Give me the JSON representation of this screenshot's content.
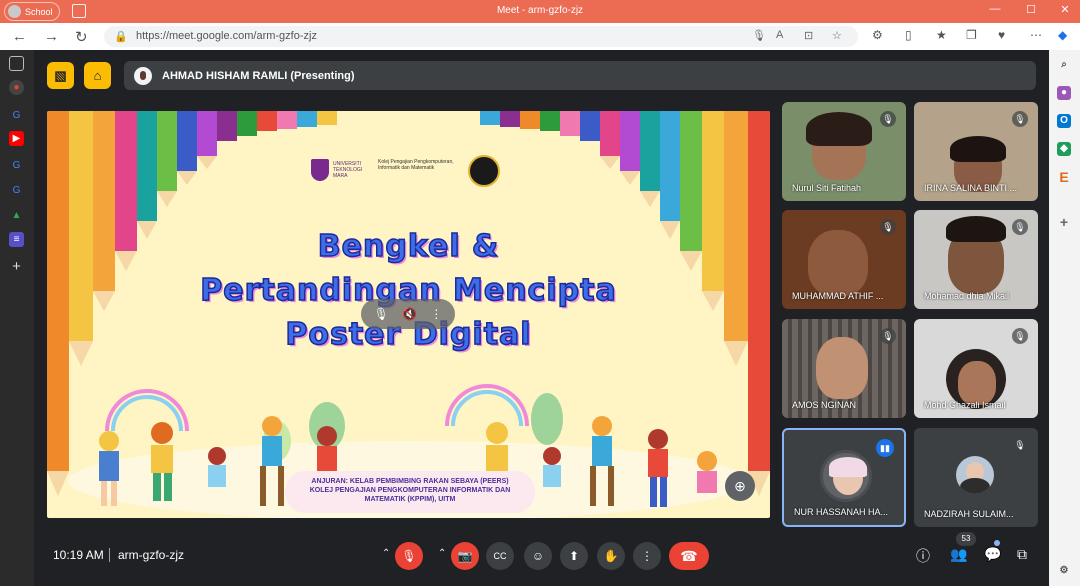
{
  "browser": {
    "profile_label": "School",
    "window_title": "Meet - arm-gzfo-zjz",
    "url": "https://meet.google.com/arm-gzfo-zjz"
  },
  "meet": {
    "presenter_label": "AHMAD HISHAM RAMLI (Presenting)",
    "time": "10:19 AM",
    "meeting_code": "arm-gzfo-zjz",
    "participant_count": "53"
  },
  "slide": {
    "title_line1": "Bengkel &",
    "title_line2": "Pertandingan Mencipta",
    "title_line3": "Poster Digital",
    "uitm_text": "UNIVERSITI TEKNOLOGI MARA",
    "kolej_text": "Kolej Pengajian Pengkomputeran, Informatik dan Matematik",
    "anjuran_line1": "ANJURAN: KELAB PEMBIMBING RAKAN SEBAYA (PEERS)",
    "anjuran_line2": "KOLEJ PENGAJIAN PENGKOMPUTERAN INFORMATIK DAN",
    "anjuran_line3": "MATEMATIK (KPPIM), UITM"
  },
  "participants": [
    {
      "name": "Nurul Siti Fatihah"
    },
    {
      "name": "IRINA SALINA BINTI ..."
    },
    {
      "name": "MUHAMMAD ATHIF ..."
    },
    {
      "name": "Mohamad dhia Mikail"
    },
    {
      "name": "AMOS NGINAN"
    },
    {
      "name": "Mohd Ghazali Ismail"
    },
    {
      "name": "NUR HASSANAH HA..."
    },
    {
      "name": "NADZIRAH SULAIM..."
    }
  ],
  "colors": {
    "accent_yellow": "#fbbc04",
    "danger_red": "#ea4335",
    "speaking_blue": "#1a73e8",
    "meet_bg": "#202124",
    "titlebar": "#ec6b53"
  }
}
